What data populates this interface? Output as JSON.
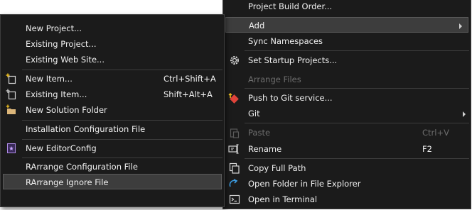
{
  "submenu": {
    "items": [
      {
        "label": "New Project..."
      },
      {
        "label": "Existing Project..."
      },
      {
        "label": "Existing Web Site..."
      },
      {
        "label": "New Item...",
        "shortcut": "Ctrl+Shift+A",
        "icon": "new-item-icon"
      },
      {
        "label": "Existing Item...",
        "shortcut": "Shift+Alt+A",
        "icon": "existing-item-icon"
      },
      {
        "label": "New Solution Folder",
        "icon": "new-folder-icon"
      },
      {
        "label": "Installation Configuration File"
      },
      {
        "label": "New EditorConfig",
        "icon": "editorconfig-icon"
      },
      {
        "label": "RArrange Configuration File"
      },
      {
        "label": "RArrange Ignore File"
      }
    ]
  },
  "context": {
    "items": [
      {
        "label": "Project Build Order..."
      },
      {
        "label": "Add"
      },
      {
        "label": "Sync Namespaces"
      },
      {
        "label": "Set Startup Projects...",
        "icon": "gear-icon"
      },
      {
        "label": "Arrange Files"
      },
      {
        "label": "Push to Git service...",
        "icon": "git-push-icon"
      },
      {
        "label": "Git"
      },
      {
        "label": "Paste",
        "shortcut": "Ctrl+V",
        "icon": "paste-icon"
      },
      {
        "label": "Rename",
        "shortcut": "F2",
        "icon": "rename-icon"
      },
      {
        "label": "Copy Full Path",
        "icon": "copy-icon"
      },
      {
        "label": "Open Folder in File Explorer",
        "icon": "folder-open-icon"
      },
      {
        "label": "Open in Terminal",
        "icon": "terminal-icon"
      }
    ]
  },
  "colors": {
    "menu_bg": "#1b1b1b",
    "highlight": "#3d3d3d",
    "text": "#f1f1f1",
    "disabled_text": "#6e6e6e"
  }
}
